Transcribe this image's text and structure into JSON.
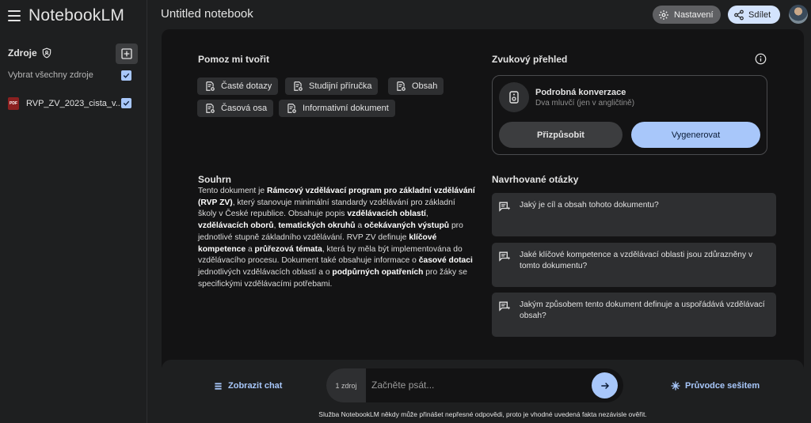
{
  "app": {
    "name": "NotebookLM"
  },
  "sidebar": {
    "sources_label": "Zdroje",
    "select_all_label": "Vybrat všechny zdroje",
    "sources": [
      {
        "name": "RVP_ZV_2023_cista_v...",
        "type_badge": "PDF"
      }
    ]
  },
  "header": {
    "notebook_title": "Untitled notebook",
    "settings_label": "Nastavení",
    "share_label": "Sdílet"
  },
  "help": {
    "title": "Pomoz mi tvořit",
    "chips": [
      "Časté dotazy",
      "Studijní příručka",
      "Obsah",
      "Časová osa",
      "Informativní dokument"
    ]
  },
  "audio": {
    "title": "Zvukový přehled",
    "card_title": "Podrobná konverzace",
    "card_subtitle": "Dva mluvčí (jen v angličtině)",
    "customize_label": "Přizpůsobit",
    "generate_label": "Vygenerovat"
  },
  "summary": {
    "title": "Souhrn",
    "segments": [
      {
        "t": "Tento dokument je ",
        "b": false
      },
      {
        "t": "Rámcový vzdělávací program pro základní vzdělávání (RVP ZV)",
        "b": true
      },
      {
        "t": ", který stanovuje minimální standardy vzdělávání pro základní školy v České republice. Obsahuje popis ",
        "b": false
      },
      {
        "t": "vzdělávacích oblastí",
        "b": true
      },
      {
        "t": ", ",
        "b": false
      },
      {
        "t": "vzdělávacích oborů",
        "b": true
      },
      {
        "t": ", ",
        "b": false
      },
      {
        "t": "tematických okruhů",
        "b": true
      },
      {
        "t": " a ",
        "b": false
      },
      {
        "t": "očekávaných výstupů",
        "b": true
      },
      {
        "t": " pro jednotlivé stupně základního vzdělávání. RVP ZV definuje ",
        "b": false
      },
      {
        "t": "klíčové kompetence",
        "b": true
      },
      {
        "t": " a ",
        "b": false
      },
      {
        "t": "průřezová témata",
        "b": true
      },
      {
        "t": ", která by měla být implementována do vzdělávacího procesu. Dokument také obsahuje informace o ",
        "b": false
      },
      {
        "t": "časové dotaci",
        "b": true
      },
      {
        "t": " jednotlivých vzdělávacích oblastí a o ",
        "b": false
      },
      {
        "t": "podpůrných opatřeních",
        "b": true
      },
      {
        "t": " pro žáky se specifickými vzdělávacími potřebami.",
        "b": false
      }
    ]
  },
  "suggested": {
    "title": "Navrhované otázky",
    "questions": [
      "Jaký je cíl a obsah tohoto dokumentu?",
      "Jaké klíčové kompetence a vzdělávací oblasti jsou zdůrazněny v tomto dokumentu?",
      "Jakým způsobem tento dokument definuje a uspořádává vzdělávací obsah?"
    ]
  },
  "chat": {
    "show_chat_label": "Zobrazit chat",
    "source_count": "1 zdroj",
    "placeholder": "Začněte psát...",
    "guide_label": "Průvodce sešitem",
    "disclaimer": "Služba NotebookLM někdy může přinášet nepřesné odpovědi, proto je vhodné uvedená fakta nezávisle ověřit."
  }
}
